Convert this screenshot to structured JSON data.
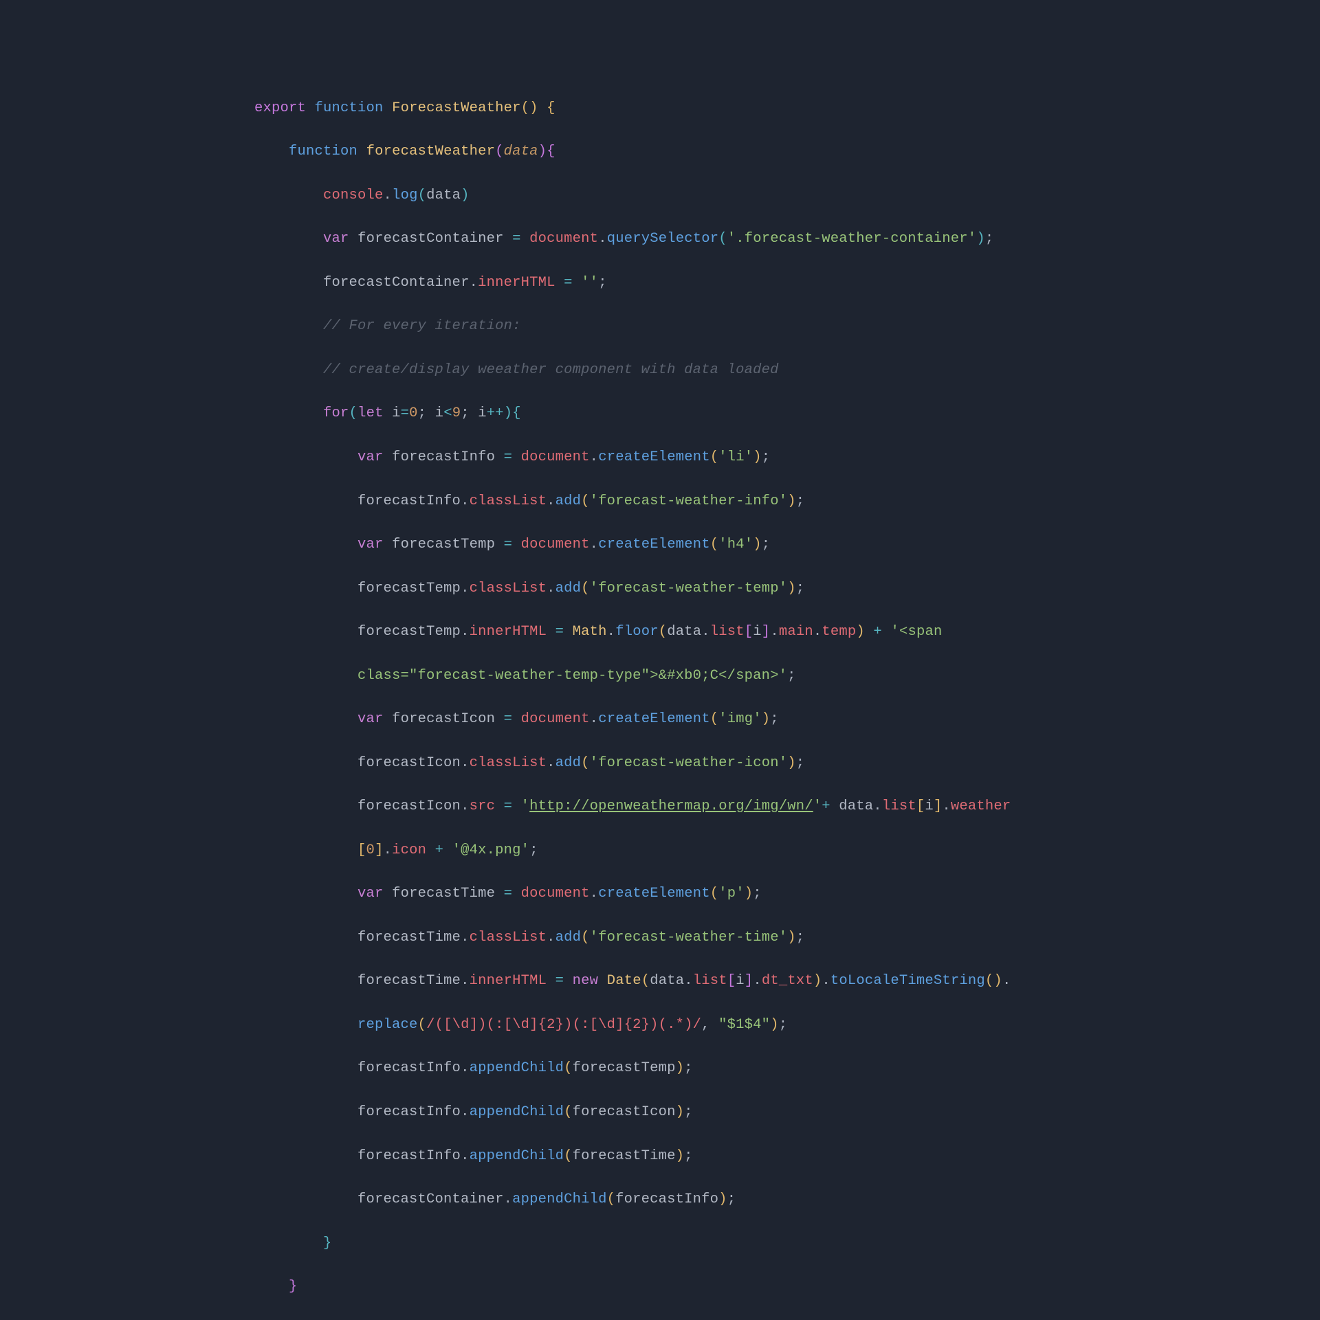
{
  "code": {
    "fn_outer": "ForecastWeather",
    "fn_inner": "forecastWeather",
    "param": "data",
    "console": "console",
    "log": "log",
    "var1": "forecastContainer",
    "document": "document",
    "querySelector": "querySelector",
    "selector": "'.forecast-weather-container'",
    "innerHTML": "innerHTML",
    "empty": "''",
    "comment1": "// For every iteration:",
    "comment2": "// create/display weeather component with data loaded",
    "for": "for",
    "let": "let",
    "i": "i",
    "eq0": "0",
    "lt": "9",
    "var2": "forecastInfo",
    "createElement": "createElement",
    "li": "'li'",
    "classList": "classList",
    "add": "add",
    "cls_info": "'forecast-weather-info'",
    "var3": "forecastTemp",
    "h4": "'h4'",
    "cls_temp": "'forecast-weather-temp'",
    "Math": "Math",
    "floor": "floor",
    "list": "list",
    "main": "main",
    "temp": "temp",
    "span1": "'<span ",
    "span2": "class=\"forecast-weather-temp-type\">&#xb0;C</span>'",
    "var4": "forecastIcon",
    "img": "'img'",
    "cls_icon": "'forecast-weather-icon'",
    "src": "src",
    "url_prefix_q": "'",
    "url": "http://openweathermap.org/img/wn/",
    "url_suffix_q": "'",
    "weather": "weather",
    "icon": "icon",
    "zero": "0",
    "at4x": "'@4x.png'",
    "var5": "forecastTime",
    "p": "'p'",
    "cls_time": "'forecast-weather-time'",
    "new": "new",
    "Date": "Date",
    "dt_txt": "dt_txt",
    "toLocaleTimeString": "toLocaleTimeString",
    "replace": "replace",
    "regex": "/([\\d])(:[\\d]{2})(:[\\d]{2})(.*)/",
    "repl_str": "\"$1$4\"",
    "appendChild": "appendChild",
    "export": "export",
    "function": "function",
    "var": "var"
  }
}
